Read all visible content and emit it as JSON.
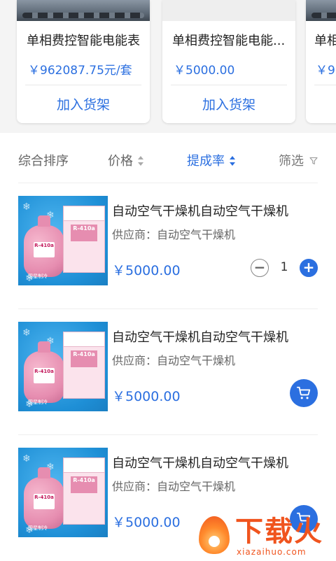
{
  "carousel": {
    "cards": [
      {
        "title": "单相费控智能电能表",
        "price": "￥962087.75元/套",
        "button": "加入货架"
      },
      {
        "title": "单相费控智能电能...",
        "price": "￥5000.00",
        "button": "加入货架"
      },
      {
        "title": "单相",
        "price": "￥96",
        "button": ""
      }
    ]
  },
  "sort_bar": {
    "items": [
      {
        "label": "综合排序"
      },
      {
        "label": "价格"
      },
      {
        "label": "提成率"
      },
      {
        "label": "筛选"
      }
    ],
    "active": "提成率"
  },
  "products": [
    {
      "title": "自动空气干燥机自动空气干燥机",
      "supplier": "供应商：自动空气干燥机",
      "price": "￥5000.00",
      "quantity": "1",
      "control": "stepper"
    },
    {
      "title": "自动空气干燥机自动空气干燥机",
      "supplier": "供应商：自动空气干燥机",
      "price": "￥5000.00",
      "control": "cart"
    },
    {
      "title": "自动空气干燥机自动空气干燥机",
      "supplier": "供应商：自动空气干燥机",
      "price": "￥5000.00",
      "control": "cart"
    }
  ],
  "thumbnail": {
    "tank_label": "R-410a",
    "box_label": "R-410a",
    "brand": "国星制冷"
  },
  "qty_controls": {
    "minus": "−",
    "plus": "+"
  },
  "watermark": {
    "text": "下载火",
    "url": "xiazaihuo.com"
  },
  "colors": {
    "accent": "#2b6fe0",
    "watermark": "#f0541e"
  }
}
